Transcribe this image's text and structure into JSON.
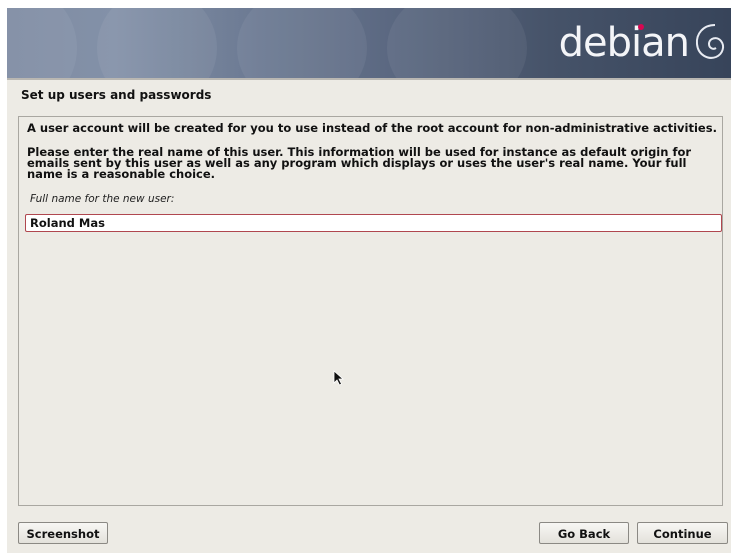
{
  "banner": {
    "logo_text": "debian",
    "logo_dot_color": "#d70751",
    "swirl_icon": "debian-swirl-icon"
  },
  "step": {
    "title": "Set up users and passwords"
  },
  "main": {
    "description_1": "A user account will be created for you to use instead of the root account for non-administrative activities.",
    "description_2": "Please enter the real name of this user. This information will be used for instance as default origin for emails sent by this user as well as any program which displays or uses the user's real name. Your full name is a reasonable choice.",
    "field_label": "Full name for the new user:",
    "field_value": "Roland Mas"
  },
  "buttons": {
    "screenshot": "Screenshot",
    "go_back": "Go Back",
    "continue": "Continue"
  },
  "colors": {
    "background": "#edebe5",
    "input_border": "#b0474f"
  }
}
